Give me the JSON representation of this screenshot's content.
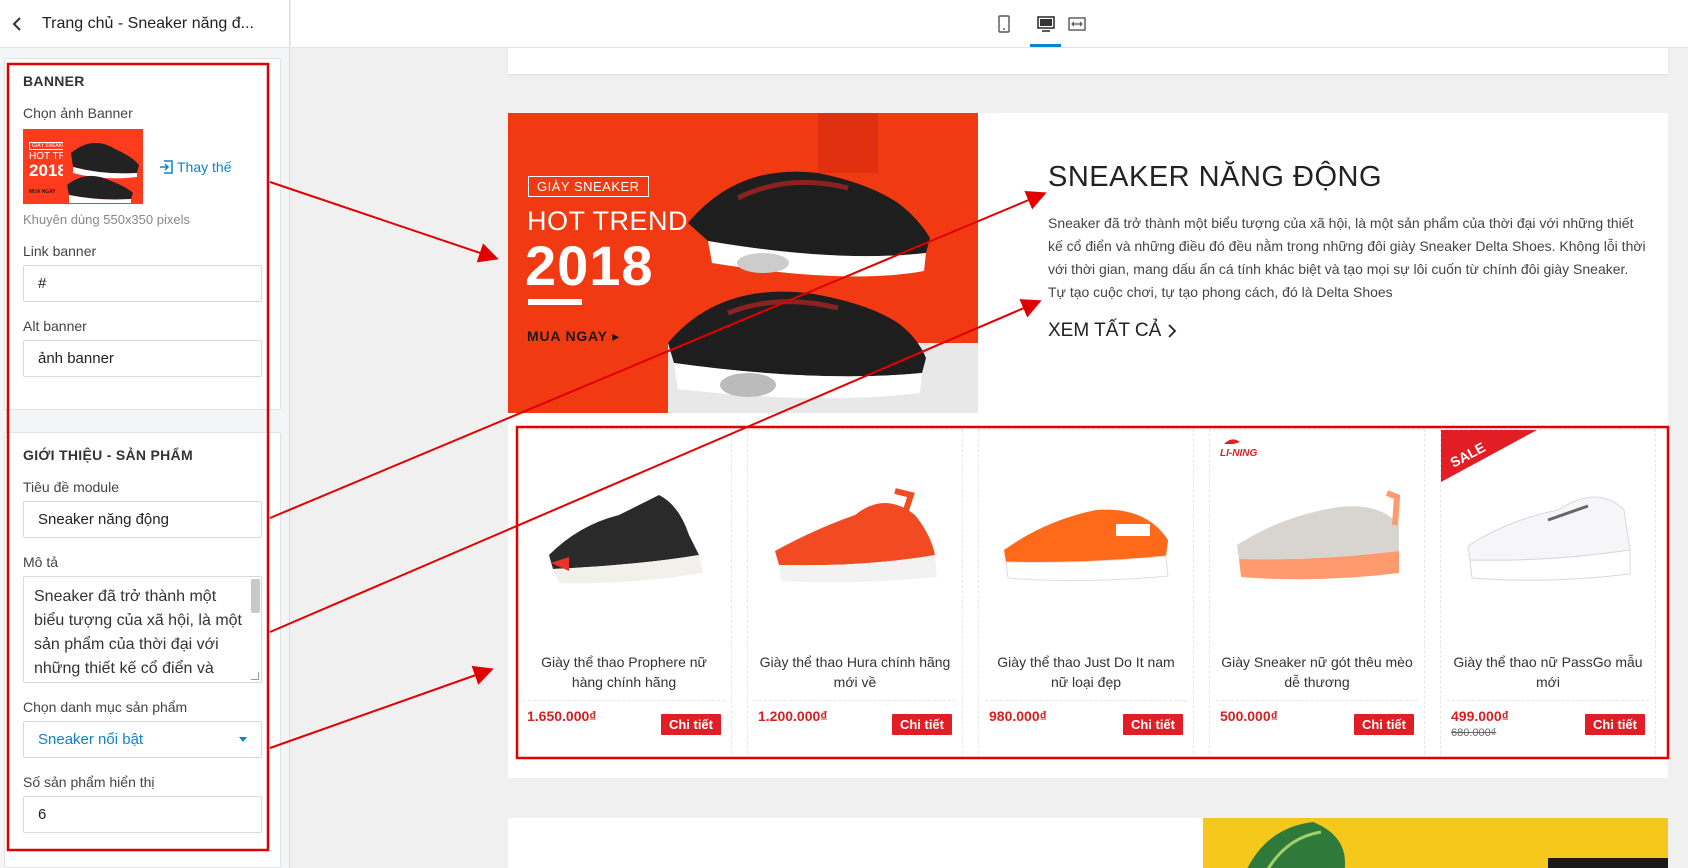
{
  "header": {
    "title": "Trang chủ - Sneaker năng đ..."
  },
  "banner": {
    "heading": "BANNER",
    "image_label": "Chọn ảnh Banner",
    "replace_label": "Thay thế",
    "hint": "Khuyên dùng 550x350 pixels",
    "link_label": "Link banner",
    "link_value": "#",
    "alt_label": "Alt banner",
    "alt_value": "ảnh banner",
    "thumb": {
      "small_tag": "GIÀY SNEAKER",
      "line1": "HOT TREND",
      "line2": "2018",
      "cta": "MUA NGAY"
    }
  },
  "intro_form": {
    "heading": "GIỚI THIỆU - SẢN PHẨM",
    "title_label": "Tiêu đề module",
    "title_value": "Sneaker năng động",
    "desc_label": "Mô tả",
    "desc_value": "Sneaker đã trở thành một biểu tượng của xã hội, là một sản phẩm của thời đại với những thiết kế cổ điển và",
    "category_label": "Chọn danh mục sản phẩm",
    "category_value": "Sneaker nổi bật",
    "count_label": "Số sản phẩm hiển thị",
    "count_value": "6"
  },
  "preview": {
    "hero": {
      "tag": "GIÀY SNEAKER",
      "line1": "HOT TREND",
      "line2": "2018",
      "cta": "MUA NGAY"
    },
    "intro": {
      "title": "SNEAKER NĂNG ĐỘNG",
      "desc": "Sneaker đã trở thành một biểu tượng của xã hội, là một sản phẩm của thời đại với những thiết kế cổ điển và những điều đó đều nằm trong những đôi giày Sneaker Delta Shoes. Không lỗi thời với thời gian, mang dấu ấn cá tính khác biệt và tạo mọi sự lôi cuốn từ chính đôi giày Sneaker. Tự tạo cuộc chơi, tự tạo phong cách, đó là Delta Shoes",
      "view_all": "XEM TẤT CẢ"
    },
    "detail_label": "Chi tiết",
    "products": [
      {
        "name": "Giày thể thao Prophere nữ hàng chính hãng",
        "price": "1.650.000₫"
      },
      {
        "name": "Giày thể thao Hura chính hãng mới về",
        "price": "1.200.000₫"
      },
      {
        "name": "Giày thể thao Just Do It nam nữ loại đẹp",
        "price": "980.000₫"
      },
      {
        "name": "Giày Sneaker nữ gót thêu mèo dễ thương",
        "price": "500.000₫",
        "badge": "LI-NING"
      },
      {
        "name": "Giày thể thao nữ PassGo mẫu mới",
        "price": "499.000₫",
        "old_price": "680.000₫",
        "badge": "SALE"
      }
    ]
  },
  "colors": {
    "accent": "#0a84cc",
    "price": "#d6201f",
    "button": "#e21d24",
    "annotation": "#e00000",
    "banner_bg": "#f23a12"
  }
}
